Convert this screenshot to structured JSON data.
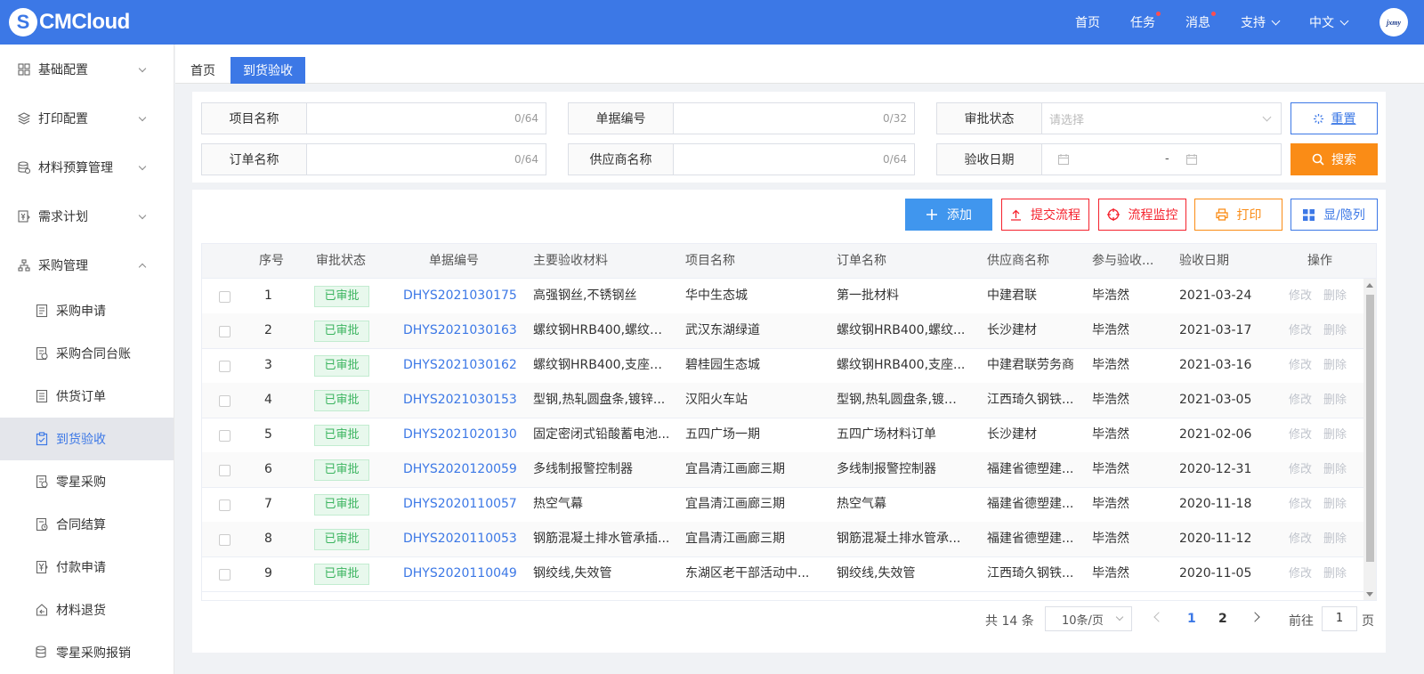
{
  "app": {
    "logo_letter": "S",
    "logo_text": "CMCloud",
    "avatar_text": "jxmy"
  },
  "topnav": [
    {
      "label": "首页",
      "dot": false,
      "chevron": false
    },
    {
      "label": "任务",
      "dot": true,
      "chevron": false
    },
    {
      "label": "消息",
      "dot": true,
      "chevron": false
    },
    {
      "label": "支持",
      "dot": false,
      "chevron": true
    },
    {
      "label": "中文",
      "dot": false,
      "chevron": true
    }
  ],
  "sidebar": {
    "groups": [
      {
        "label": "基础配置",
        "icon": "grid-icon",
        "expanded": false
      },
      {
        "label": "打印配置",
        "icon": "layers-icon",
        "expanded": false
      },
      {
        "label": "材料预算管理",
        "icon": "database-icon",
        "expanded": false
      },
      {
        "label": "需求计划",
        "icon": "yen-doc-icon",
        "expanded": false
      },
      {
        "label": "采购管理",
        "icon": "org-icon",
        "expanded": true
      }
    ],
    "sub_items": [
      {
        "label": "采购申请",
        "icon": "document-icon"
      },
      {
        "label": "采购合同台账",
        "icon": "contract-icon"
      },
      {
        "label": "供货订单",
        "icon": "list-doc-icon"
      },
      {
        "label": "到货验收",
        "icon": "clipboard-check-icon",
        "active": true
      },
      {
        "label": "零星采购",
        "icon": "contract-icon"
      },
      {
        "label": "合同结算",
        "icon": "settle-icon"
      },
      {
        "label": "付款申请",
        "icon": "yen-doc-icon"
      },
      {
        "label": "材料退货",
        "icon": "return-icon"
      },
      {
        "label": "零星采购报销",
        "icon": "database-icon"
      }
    ]
  },
  "tabs": {
    "home": "首页",
    "active": "到货验收"
  },
  "filters": {
    "project_name": {
      "label": "项目名称",
      "count": "0/64"
    },
    "doc_no": {
      "label": "单据编号",
      "count": "0/32"
    },
    "approval_status": {
      "label": "审批状态",
      "placeholder": "请选择"
    },
    "order_name": {
      "label": "订单名称",
      "count": "0/64"
    },
    "supplier_name": {
      "label": "供应商名称",
      "count": "0/64"
    },
    "accept_date": {
      "label": "验收日期",
      "separator": "-"
    },
    "reset_label": "重置",
    "search_label": "搜索"
  },
  "actions": {
    "add": "添加",
    "submit_flow": "提交流程",
    "flow_monitor": "流程监控",
    "print": "打印",
    "toggle_columns": "显/隐列"
  },
  "table": {
    "headers": [
      "序号",
      "审批状态",
      "单据编号",
      "主要验收材料",
      "项目名称",
      "订单名称",
      "供应商名称",
      "参与验收...",
      "验收日期",
      "操作"
    ],
    "rows": [
      {
        "no": "1",
        "status": "已审批",
        "doc": "DHYS2021030175",
        "material": "高强钢丝,不锈钢丝",
        "project": "华中生态城",
        "order": "第一批材料",
        "supplier": "中建君联",
        "participant": "毕浩然",
        "date": "2021-03-24",
        "edit": "修改",
        "del": "删除"
      },
      {
        "no": "2",
        "status": "已审批",
        "doc": "DHYS2021030163",
        "material": "螺纹钢HRB400,螺纹钢...",
        "project": "武汉东湖绿道",
        "order": "螺纹钢HRB400,螺纹...",
        "supplier": "长沙建材",
        "participant": "毕浩然",
        "date": "2021-03-17",
        "edit": "修改",
        "del": "删除"
      },
      {
        "no": "3",
        "status": "已审批",
        "doc": "DHYS2021030162",
        "material": "螺纹钢HRB400,支座钢...",
        "project": "碧桂园生态城",
        "order": "螺纹钢HRB400,支座...",
        "supplier": "中建君联劳务商",
        "participant": "毕浩然",
        "date": "2021-03-16",
        "edit": "修改",
        "del": "删除"
      },
      {
        "no": "4",
        "status": "已审批",
        "doc": "DHYS2021030153",
        "material": "型钢,热轧圆盘条,镀锌...",
        "project": "汉阳火车站",
        "order": "型钢,热轧圆盘条,镀锌...",
        "supplier": "江西琦久钢铁...",
        "participant": "毕浩然",
        "date": "2021-03-05",
        "edit": "修改",
        "del": "删除"
      },
      {
        "no": "5",
        "status": "已审批",
        "doc": "DHYS2021020130",
        "material": "固定密闭式铅酸蓄电池...",
        "project": "五四广场一期",
        "order": "五四广场材料订单",
        "supplier": "长沙建材",
        "participant": "毕浩然",
        "date": "2021-02-06",
        "edit": "修改",
        "del": "删除"
      },
      {
        "no": "6",
        "status": "已审批",
        "doc": "DHYS2020120059",
        "material": "多线制报警控制器",
        "project": "宜昌清江画廊三期",
        "order": "多线制报警控制器",
        "supplier": "福建省德塑建...",
        "participant": "毕浩然",
        "date": "2020-12-31",
        "edit": "修改",
        "del": "删除"
      },
      {
        "no": "7",
        "status": "已审批",
        "doc": "DHYS2020110057",
        "material": "热空气幕",
        "project": "宜昌清江画廊三期",
        "order": "热空气幕",
        "supplier": "福建省德塑建...",
        "participant": "毕浩然",
        "date": "2020-11-18",
        "edit": "修改",
        "del": "删除"
      },
      {
        "no": "8",
        "status": "已审批",
        "doc": "DHYS2020110053",
        "material": "钢筋混凝土排水管承插...",
        "project": "宜昌清江画廊三期",
        "order": "钢筋混凝土排水管承...",
        "supplier": "福建省德塑建...",
        "participant": "毕浩然",
        "date": "2020-11-12",
        "edit": "修改",
        "del": "删除"
      },
      {
        "no": "9",
        "status": "已审批",
        "doc": "DHYS2020110049",
        "material": "钢绞线,失效管",
        "project": "东湖区老干部活动中...",
        "order": "钢绞线,失效管",
        "supplier": "江西琦久钢铁...",
        "participant": "毕浩然",
        "date": "2020-11-05",
        "edit": "修改",
        "del": "删除"
      }
    ]
  },
  "pagination": {
    "total": "共 14 条",
    "page_size": "10条/页",
    "current_page": "1",
    "page_2": "2",
    "goto_prefix": "前往",
    "goto_value": "1",
    "goto_suffix": "页"
  },
  "colors": {
    "primary": "#3c78e6",
    "warning": "#fa8c16",
    "danger": "#f5222d",
    "success": "#3bb45f"
  }
}
